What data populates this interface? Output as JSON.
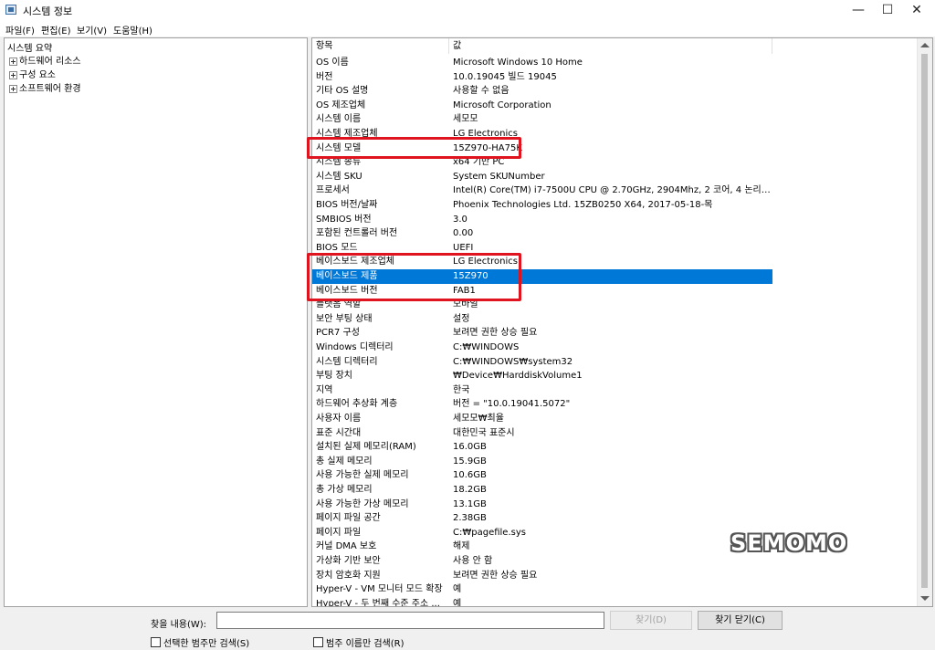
{
  "window": {
    "title": "시스템 정보",
    "controls": [
      "—",
      "☐",
      "✕"
    ]
  },
  "menu": [
    "파일(F)",
    "편집(E)",
    "보기(V)",
    "도움말(H)"
  ],
  "tree": {
    "root": "시스템 요약",
    "children": [
      "하드웨어 리소스",
      "구성 요소",
      "소프트웨어 환경"
    ]
  },
  "table": {
    "headers": [
      "항목",
      "값"
    ],
    "rows": [
      {
        "k": "OS 이름",
        "v": "Microsoft Windows 10 Home"
      },
      {
        "k": "버전",
        "v": "10.0.19045 빌드 19045"
      },
      {
        "k": "기타 OS 설명",
        "v": "사용할 수 없음"
      },
      {
        "k": "OS 제조업체",
        "v": "Microsoft Corporation"
      },
      {
        "k": "시스템 이름",
        "v": "세모모"
      },
      {
        "k": "시스템 제조업체",
        "v": "LG Electronics"
      },
      {
        "k": "시스템 모델",
        "v": "15Z970-HA75K"
      },
      {
        "k": "시스템 종류",
        "v": "x64 기반 PC"
      },
      {
        "k": "시스템 SKU",
        "v": "System SKUNumber"
      },
      {
        "k": "프로세서",
        "v": "Intel(R) Core(TM) i7-7500U CPU @ 2.70GHz, 2904Mhz, 2 코어, 4 논리 프로..."
      },
      {
        "k": "BIOS 버전/날짜",
        "v": "Phoenix Technologies Ltd. 15ZB0250 X64, 2017-05-18-목"
      },
      {
        "k": "SMBIOS 버전",
        "v": "3.0"
      },
      {
        "k": "포함된 컨트롤러 버전",
        "v": "0.00"
      },
      {
        "k": "BIOS 모드",
        "v": "UEFI"
      },
      {
        "k": "베이스보드 제조업체",
        "v": "LG Electronics"
      },
      {
        "k": "베이스보드 제품",
        "v": "15Z970"
      },
      {
        "k": "베이스보드 버전",
        "v": "FAB1"
      },
      {
        "k": "플랫폼 역할",
        "v": "모바일"
      },
      {
        "k": "보안 부팅 상태",
        "v": "설정"
      },
      {
        "k": "PCR7 구성",
        "v": "보려면 권한 상승 필요"
      },
      {
        "k": "Windows 디렉터리",
        "v": "C:₩WINDOWS"
      },
      {
        "k": "시스템 디렉터리",
        "v": "C:₩WINDOWS₩system32"
      },
      {
        "k": "부팅 장치",
        "v": "₩Device₩HarddiskVolume1"
      },
      {
        "k": "지역",
        "v": "한국"
      },
      {
        "k": "하드웨어 추상화 계층",
        "v": "버전 = \"10.0.19041.5072\""
      },
      {
        "k": "사용자 이름",
        "v": "세모모₩최율"
      },
      {
        "k": "표준 시간대",
        "v": "대한민국 표준시"
      },
      {
        "k": "설치된 실제 메모리(RAM)",
        "v": "16.0GB"
      },
      {
        "k": "총 실제 메모리",
        "v": "15.9GB"
      },
      {
        "k": "사용 가능한 실제 메모리",
        "v": "10.6GB"
      },
      {
        "k": "총 가상 메모리",
        "v": "18.2GB"
      },
      {
        "k": "사용 가능한 가상 메모리",
        "v": "13.1GB"
      },
      {
        "k": "페이지 파일 공간",
        "v": "2.38GB"
      },
      {
        "k": "페이지 파일",
        "v": "C:₩pagefile.sys"
      },
      {
        "k": "커널 DMA 보호",
        "v": "해제"
      },
      {
        "k": "가상화 기반 보안",
        "v": "사용 안 함"
      },
      {
        "k": "장치 암호화 지원",
        "v": "보려면 권한 상승 필요"
      },
      {
        "k": "Hyper-V - VM 모니터 모드 확장",
        "v": "예"
      },
      {
        "k": "Hyper-V - 두 번째 수준 주소 ...",
        "v": "예"
      }
    ],
    "selected_key": "베이스보드 제품"
  },
  "watermark": "SEMOMO",
  "find": {
    "label": "찾을 내용(W):",
    "value": "",
    "find_button": "찾기(D)",
    "close_button": "찾기 닫기(C)",
    "checkbox_selected_only": "선택한 범주만 검색(S)",
    "checkbox_category_names": "범주 이름만 검색(R)"
  },
  "colors": {
    "selection": "#0078d7",
    "highlight_box": "#e0141e"
  }
}
